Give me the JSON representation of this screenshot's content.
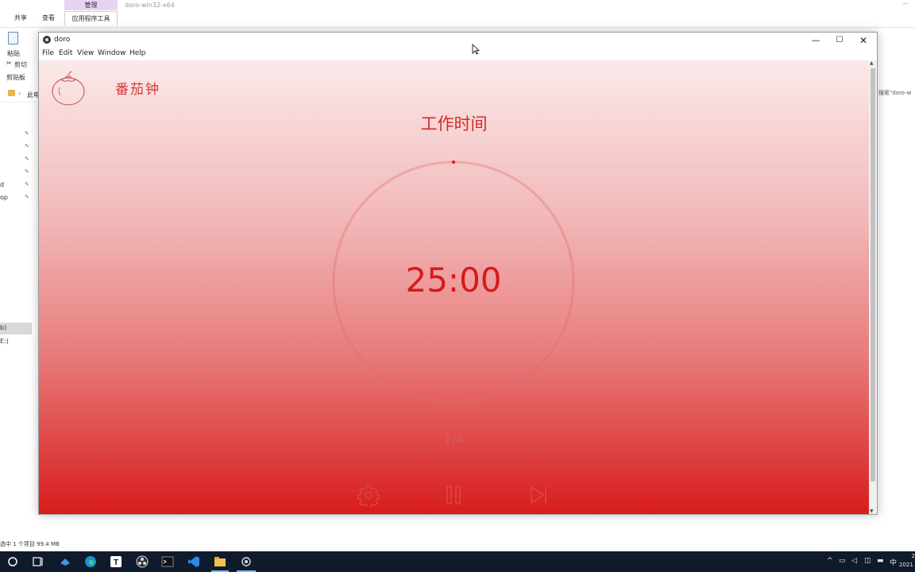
{
  "background_window": {
    "context_tab": "管理",
    "context_group": "应用程序工具",
    "window_title": "doro-win32-x64",
    "ribbon_tabs": [
      "共享",
      "查看"
    ],
    "paste_label": "粘贴",
    "cut_label": "剪切",
    "clipboard_label": "剪贴板",
    "address_fragment": "此电",
    "search_placeholder": "搜索\"doro-w",
    "nav_items": [
      "d",
      "op",
      "b)",
      "E:)"
    ],
    "status_text": "选中 1 个项目  99.4 MB"
  },
  "app": {
    "title": "doro",
    "menu": [
      "File",
      "Edit",
      "View",
      "Window",
      "Help"
    ],
    "brand_name": "番茄钟",
    "mode_title": "工作时间",
    "timer": "25:00",
    "round": "1/4",
    "progress": 0,
    "accent_color": "#d61a1a",
    "controls": {
      "settings_icon": "gear-icon",
      "pause_icon": "pause-icon",
      "skip_icon": "skip-forward-icon"
    }
  },
  "taskbar": {
    "icons": [
      "start-icon",
      "search-icon",
      "task-view-icon",
      "sound-icon",
      "edge-icon",
      "typora-icon",
      "obs-icon",
      "terminal-icon",
      "vscode-icon",
      "file-explorer-icon",
      "doro-icon"
    ],
    "ime": "中",
    "clock_line1": "2",
    "clock_line2": "2021"
  }
}
